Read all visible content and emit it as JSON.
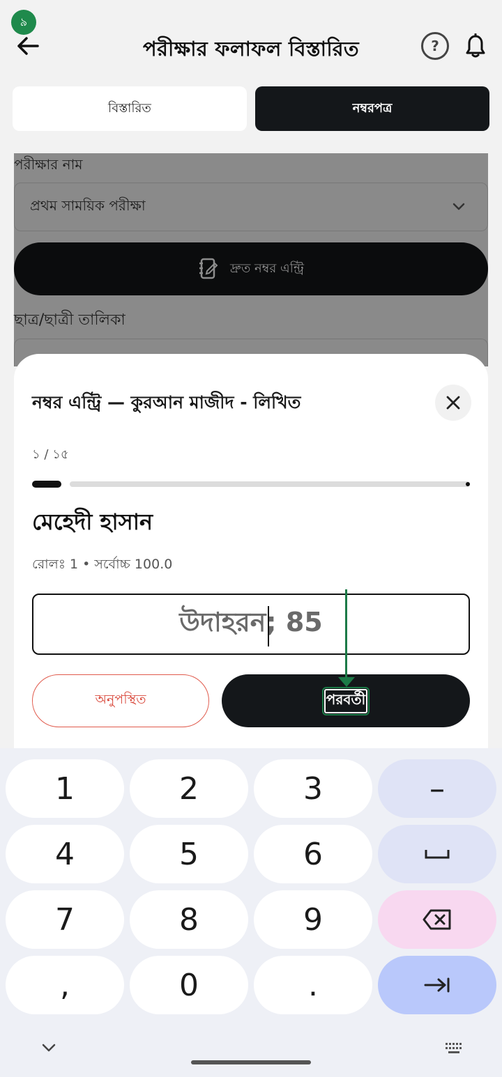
{
  "status": {
    "badge": "৯"
  },
  "header": {
    "title": "পরীক্ষার ফলাফল বিস্তারিত",
    "help_label": "?"
  },
  "tabs": [
    {
      "label": "বিস্তারিত",
      "selected": false
    },
    {
      "label": "নম্বরপত্র",
      "selected": true
    }
  ],
  "background": {
    "exam_label": "পরীক্ষার নাম",
    "exam_select_value": "প্রথম সাময়িক পরীক্ষা",
    "quick_entry_label": "দ্রুত নম্বর এন্ট্রি",
    "student_list_label": "ছাত্র/ছাত্রী তালিকা"
  },
  "sheet": {
    "title": "নম্বর এন্ট্রি — কুরআন মাজীদ - লিখিত",
    "progress_text": "১ / ১৫",
    "progress_fraction": 0.067,
    "student_name": "মেহেদী হাসান",
    "student_meta": "রোলঃ 1  •  সর্বোচ্চ 100.0",
    "input_placeholder": "উদাহরন; 85",
    "absent_label": "অনুপস্থিত",
    "next_label": "পরবর্তী"
  },
  "keyboard": {
    "rows": [
      [
        "1",
        "2",
        "3",
        "–"
      ],
      [
        "4",
        "5",
        "6",
        "␣"
      ],
      [
        "7",
        "8",
        "9",
        "⌫"
      ],
      [
        ",",
        "0",
        ".",
        "→|"
      ]
    ]
  },
  "colors": {
    "accent_green": "#1c7a47",
    "dark_button": "#14171a",
    "absent_red": "#d9483b"
  }
}
